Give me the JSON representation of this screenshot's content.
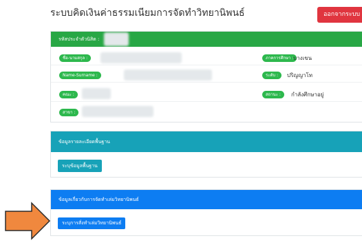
{
  "header": {
    "title": "ระบบคิดเงินค่าธรรมเนียมการจัดทำวิทยานิพนธ์",
    "logout_label": "ออกจากระบบ"
  },
  "student_panel": {
    "header_label": "รหัสประจำตัวนิสิต :",
    "fields": {
      "name_th": "ชื่อ-นามสกุล :",
      "name_en": "Name-Surname :",
      "faculty": "คณะ :",
      "major": "สาขา :",
      "program_label": "ภาคการศึกษา :",
      "program_value": "บางเขน",
      "level_label": "ระดับ :",
      "level_value": "ปริญญาโท",
      "status_label": "สถานะ :",
      "status_value": "กำลังศึกษาอยู่"
    },
    "colors": {
      "header": "#28a745",
      "badge": "#2db84d"
    }
  },
  "basic_info_panel": {
    "header_label": "ข้อมูลรายละเอียดพื้นฐาน",
    "button_label": "ระบุข้อมูลพื้นฐาน",
    "color": "#17a2b8"
  },
  "thesis_panel": {
    "header_label": "ข้อมูลเกี่ยวกับการจัดทำเล่มวิทยานิพนธ์",
    "button_label": "ระบุการสั่งทำเล่มวิทยานิพนธ์",
    "color": "#0d7df2"
  },
  "annotation": {
    "arrow_color": "#f0883e",
    "arrow_icon": "right-arrow-icon"
  }
}
